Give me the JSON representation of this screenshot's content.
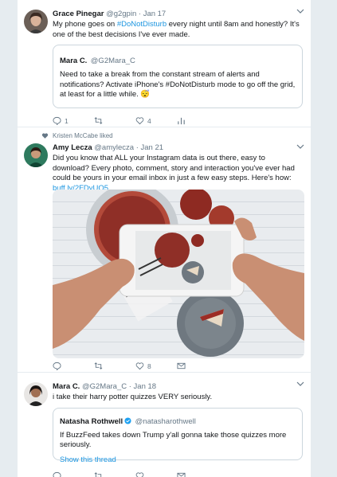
{
  "tweets": [
    {
      "name": "Grace Pinegar",
      "handle": "@g2gpin",
      "dot": "·",
      "time": "Jan 17",
      "text_pre": "My phone goes on ",
      "text_hash": "#DoNotDisturb",
      "text_post": " every night until 8am and honestly? It's one of the best decisions I've ever made.",
      "quote": {
        "name": "Mara C.",
        "handle": "@G2Mara_C",
        "text": "Need to take a break from the constant stream of alerts and notifications? Activate iPhone's #DoNotDisturb mode to go off the grid, at least for a little while. 😴"
      },
      "reply_count": "1",
      "retweet_count": "",
      "like_count": "4"
    },
    {
      "liked_by": "Kristen McCabe liked",
      "name": "Amy Lecza",
      "handle": "@amylecza",
      "dot": "·",
      "time": "Jan 21",
      "text": "Did you know that ALL your Instagram data is out there, easy to download? Every photo, comment, story and interaction you've ever had could be yours in your email inbox in just a few easy steps. Here's how: ",
      "link": "buff.ly/2FDvUQ5",
      "reply_count": "",
      "retweet_count": "",
      "like_count": "8"
    },
    {
      "name": "Mara C.",
      "handle": "@G2Mara_C",
      "dot": "·",
      "time": "Jan 18",
      "text": "i take their harry potter quizzes VERY seriously.",
      "quote": {
        "name": "Natasha Rothwell",
        "handle": "@natasharothwell",
        "text": "If BuzzFeed takes down Trump y'all gonna take those quizzes more seriously.",
        "show_thread": "Show this thread"
      }
    }
  ],
  "colors": {
    "link": "#1b95e0",
    "muted": "#657786",
    "border": "#e6ecf0"
  },
  "icons": [
    "reply-icon",
    "retweet-icon",
    "like-icon",
    "analytics-icon",
    "dm-icon",
    "chevron-down-icon",
    "verified-icon"
  ]
}
